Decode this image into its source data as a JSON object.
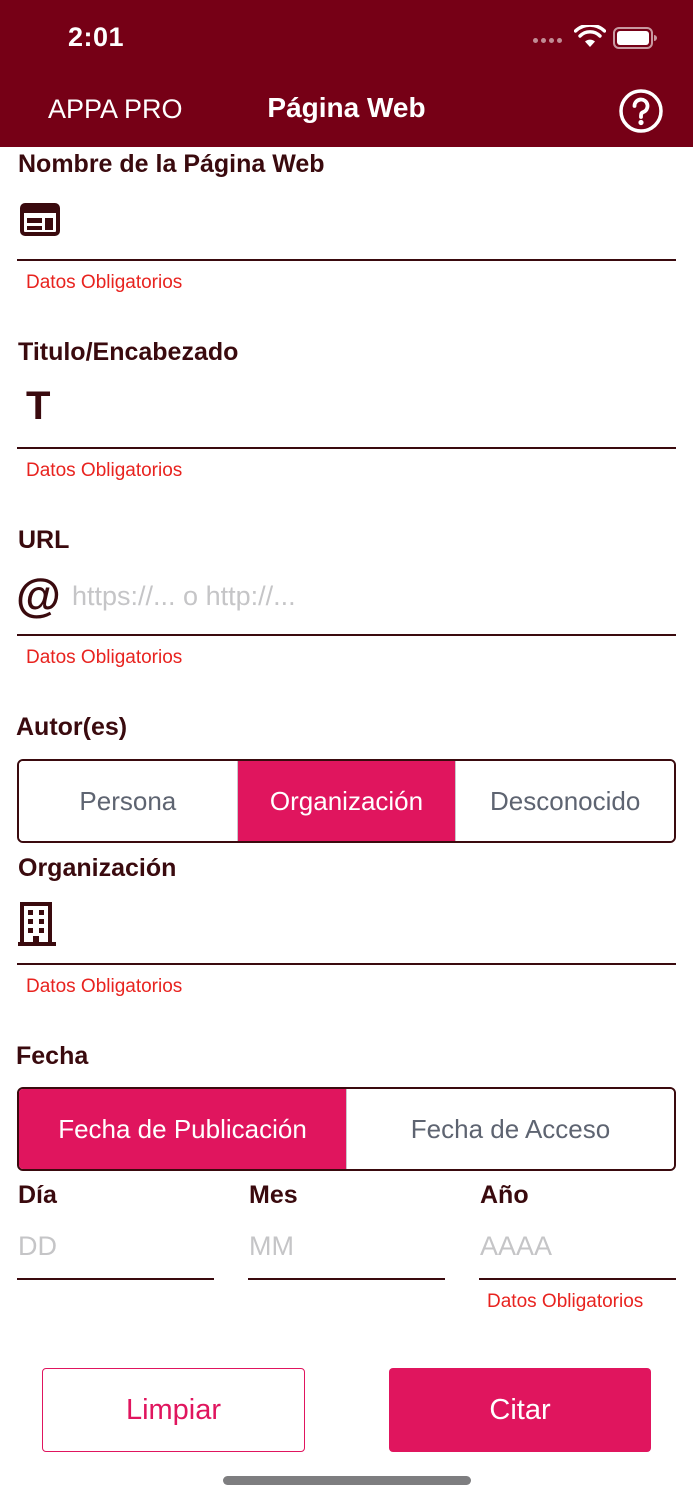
{
  "status_bar": {
    "time": "2:01"
  },
  "nav": {
    "back_label": "APPA PRO",
    "title": "Página Web",
    "help_icon": "question-circle-icon"
  },
  "sections": {
    "website_name": {
      "label": "Nombre de la Página Web",
      "icon": "web-window-icon",
      "value": "",
      "required": "Datos Obligatorios"
    },
    "title": {
      "label": "Titulo/Encabezado",
      "icon_glyph": "T",
      "value": "",
      "required": "Datos Obligatorios"
    },
    "url": {
      "label": "URL",
      "icon_glyph": "@",
      "value": "",
      "placeholder": "https://... o http://...",
      "required": "Datos Obligatorios"
    },
    "authors": {
      "label": "Autor(es)",
      "options": [
        "Persona",
        "Organización",
        "Desconocido"
      ],
      "selected": "Organización"
    },
    "organization": {
      "label": "Organización",
      "icon": "building-icon",
      "value": "",
      "required": "Datos Obligatorios"
    },
    "date": {
      "label": "Fecha",
      "options": [
        "Fecha de Publicación",
        "Fecha de Acceso"
      ],
      "selected": "Fecha de Publicación",
      "day": {
        "label": "Día",
        "placeholder": "DD",
        "value": ""
      },
      "month": {
        "label": "Mes",
        "placeholder": "MM",
        "value": ""
      },
      "year": {
        "label": "Año",
        "placeholder": "AAAA",
        "value": ""
      },
      "required": "Datos Obligatorios"
    }
  },
  "actions": {
    "clear_label": "Limpiar",
    "cite_label": "Citar"
  },
  "colors": {
    "header": "#760016",
    "accent": "#e0155e",
    "text": "#3a0a0e",
    "error": "#e8231f"
  }
}
